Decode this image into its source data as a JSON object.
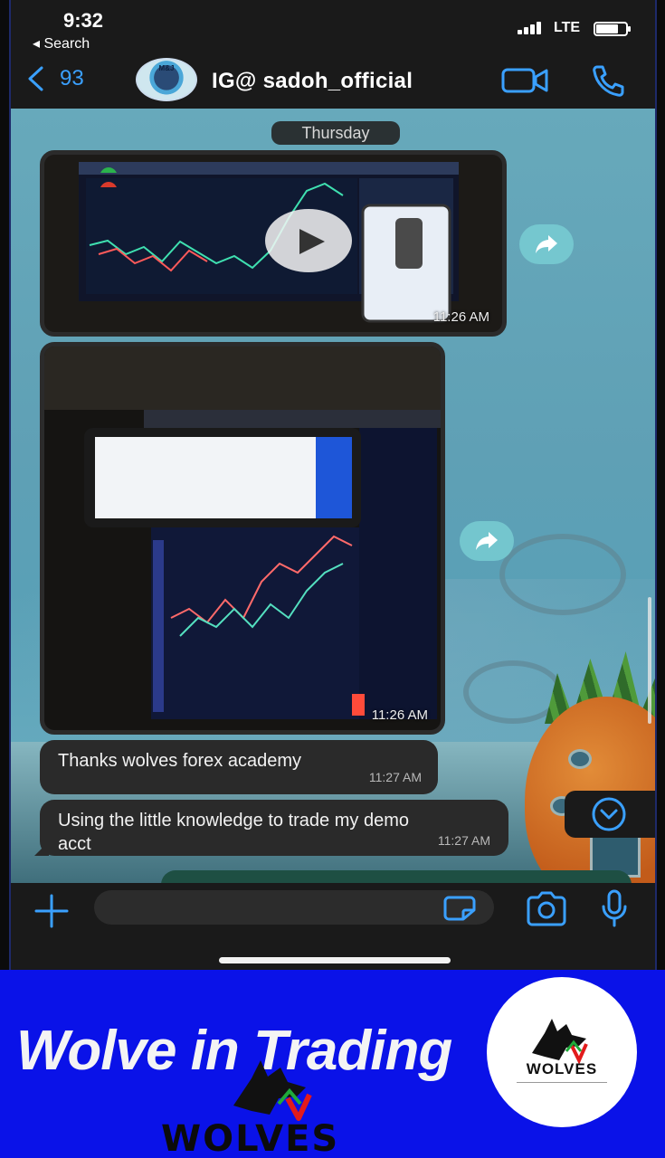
{
  "status_bar": {
    "time": "9:32",
    "back_label": "◂ Search",
    "network": "LTE",
    "battery_level": 0.75
  },
  "header": {
    "back_count": "93",
    "contact_name": "IG@ sadoh_official",
    "avatar_text": "M&J",
    "accent_color": "#3aa0ff"
  },
  "chat": {
    "date_label": "Thursday",
    "media": [
      {
        "type": "video",
        "time": "11:26 AM"
      },
      {
        "type": "image",
        "time": "11:26 AM"
      }
    ],
    "messages": [
      {
        "text": "Thanks wolves forex academy",
        "time": "11:27 AM"
      },
      {
        "text": "Using the little knowledge to trade my demo acct",
        "time": "11:27 AM"
      }
    ]
  },
  "composer": {
    "placeholder": ""
  },
  "banner": {
    "title": "Wolve in Trading",
    "logo_text": "WOLVES",
    "badge_text": "WOLVES",
    "background": "#0a12e8"
  }
}
